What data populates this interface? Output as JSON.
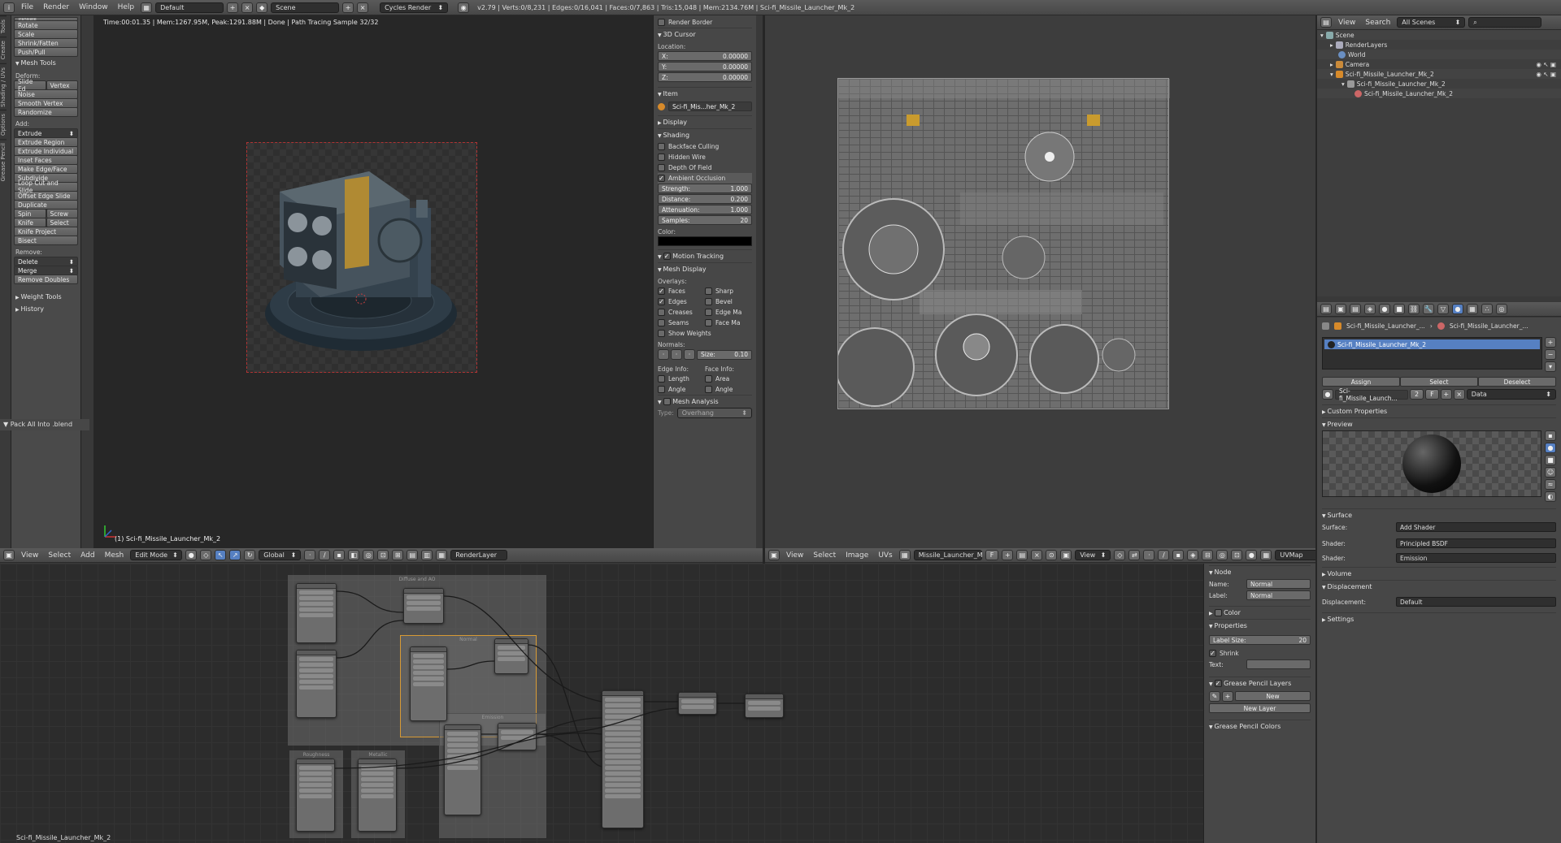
{
  "top_header": {
    "menus": [
      "File",
      "Render",
      "Window",
      "Help"
    ],
    "layout": "Default",
    "scene": "Scene",
    "engine": "Cycles Render",
    "stats": "v2.79 | Verts:0/8,231 | Edges:0/16,041 | Faces:0/7,863 | Tris:15,048 | Mem:2134.76M | Sci-fi_Missile_Launcher_Mk_2"
  },
  "viewport": {
    "render_info": "Time:00:01.35 | Mem:1267.95M, Peak:1291.88M | Done | Path Tracing Sample 32/32",
    "object_label": "(1) Sci-fi_Missile_Launcher_Mk_2",
    "header_menus": [
      "View",
      "Select",
      "Add",
      "Mesh"
    ],
    "mode": "Edit Mode",
    "orientation": "Global",
    "render_layer": "RenderLayer"
  },
  "toolshelf": {
    "tabs": [
      "Tools",
      "Create",
      "Shading / UVs",
      "Options",
      "Grease Pencil"
    ],
    "transform_top": "Translate",
    "transform": [
      "Rotate",
      "Scale",
      "Shrink/Fatten",
      "Push/Pull"
    ],
    "mesh_tools_title": "Mesh Tools",
    "deform_label": "Deform:",
    "deform_row": [
      "Slide Ed",
      "Vertex"
    ],
    "deform": [
      "Noise",
      "Smooth Vertex",
      "Randomize"
    ],
    "add_label": "Add:",
    "extrude": "Extrude",
    "add": [
      "Extrude Region",
      "Extrude Individual",
      "Inset Faces",
      "Make Edge/Face",
      "Subdivide",
      "Loop Cut and Slide",
      "Offset Edge Slide",
      "Duplicate"
    ],
    "spin_row": [
      "Spin",
      "Screw"
    ],
    "knife_row": [
      "Knife",
      "Select"
    ],
    "add2": [
      "Knife Project",
      "Bisect"
    ],
    "remove_label": "Remove:",
    "delete": "Delete",
    "merge": "Merge",
    "remove_doubles": "Remove Doubles",
    "weight_tools": "Weight Tools",
    "history": "History",
    "pack_all": "Pack All Into .blend"
  },
  "npanel": {
    "render_border": "Render Border",
    "cursor_title": "3D Cursor",
    "location_label": "Location:",
    "x_label": "X:",
    "x": "0.00000",
    "y_label": "Y:",
    "y": "0.00000",
    "z_label": "Z:",
    "z": "0.00000",
    "item_title": "Item",
    "item_name": "Sci-fi_Mis...her_Mk_2",
    "display_title": "Display",
    "shading_title": "Shading",
    "backface": "Backface Culling",
    "hidden_wire": "Hidden Wire",
    "dof": "Depth Of Field",
    "ao": "Ambient Occlusion",
    "strength_label": "Strength:",
    "strength": "1.000",
    "distance_label": "Distance:",
    "distance": "0.200",
    "attenuation_label": "Attenuation:",
    "attenuation": "1.000",
    "samples_label": "Samples:",
    "samples": "20",
    "color_label": "Color:",
    "motion_tracking": "Motion Tracking",
    "mesh_display": "Mesh Display",
    "overlays_label": "Overlays:",
    "faces": "Faces",
    "sharp": "Sharp",
    "edges": "Edges",
    "bevel": "Bevel",
    "creases": "Creases",
    "edge_ma": "Edge Ma",
    "seams": "Seams",
    "face_ma": "Face Ma",
    "show_weights": "Show Weights",
    "normals_label": "Normals:",
    "size_label": "Size:",
    "size": "0.10",
    "edge_info": "Edge Info:",
    "face_info": "Face Info:",
    "length": "Length",
    "area": "Area",
    "angle1": "Angle",
    "angle2": "Angle",
    "mesh_analysis": "Mesh Analysis",
    "type_label": "Type:",
    "type": "Overhang"
  },
  "uv_editor": {
    "header_menus": [
      "View",
      "Select",
      "Image",
      "UVs"
    ],
    "image_name": "Missile_Launcher_M",
    "f_label": "F",
    "view": "View",
    "uvmap": "UVMap"
  },
  "node_editor": {
    "material_label": "Sci-fi_Missile_Launcher_Mk_2",
    "frame_titles": [
      "Diffuse and AO",
      "Normal",
      "Roughness",
      "Metallic",
      "Emission"
    ]
  },
  "node_sidebar": {
    "node_title": "Node",
    "name_label": "Name:",
    "name": "Normal",
    "label_label": "Label:",
    "label": "Normal",
    "color_title": "Color",
    "properties_title": "Properties",
    "label_size_label": "Label Size:",
    "label_size": "20",
    "shrink": "Shrink",
    "text_label": "Text:",
    "gp_layers": "Grease Pencil Layers",
    "new": "New",
    "new_layer": "New Layer",
    "gp_colors": "Grease Pencil Colors"
  },
  "outliner": {
    "view": "View",
    "search": "Search",
    "scenes": "All Scenes",
    "items": [
      "Scene",
      "RenderLayers",
      "World",
      "Camera",
      "Sci-fi_Missile_Launcher_Mk_2",
      "Sci-fi_Missile_Launcher_Mk_2",
      "Sci-fi_Missile_Launcher_Mk_2"
    ]
  },
  "properties": {
    "breadcrumb_a": "Sci-fi_Missile_Launcher_...",
    "breadcrumb_b": "Sci-fi_Missile_Launcher_...",
    "slot": "Sci-fi_Missile_Launcher_Mk_2",
    "assign": "Assign",
    "select": "Select",
    "deselect": "Deselect",
    "material_field": "Sci-fi_Missile_Launch...",
    "users": "2",
    "f_label": "F",
    "data": "Data",
    "custom_props": "Custom Properties",
    "preview": "Preview",
    "surface_title": "Surface",
    "surface_label": "Surface:",
    "surface": "Add Shader",
    "shader1_label": "Shader:",
    "shader1": "Principled BSDF",
    "shader2_label": "Shader:",
    "shader2": "Emission",
    "volume": "Volume",
    "displacement_title": "Displacement",
    "displacement_label": "Displacement:",
    "displacement": "Default",
    "settings": "Settings"
  },
  "colors": {
    "selection_blue": "#5680c2",
    "header": "#4d4d4d",
    "frame_selected": "#d79a35",
    "render_border": "#b03333"
  }
}
